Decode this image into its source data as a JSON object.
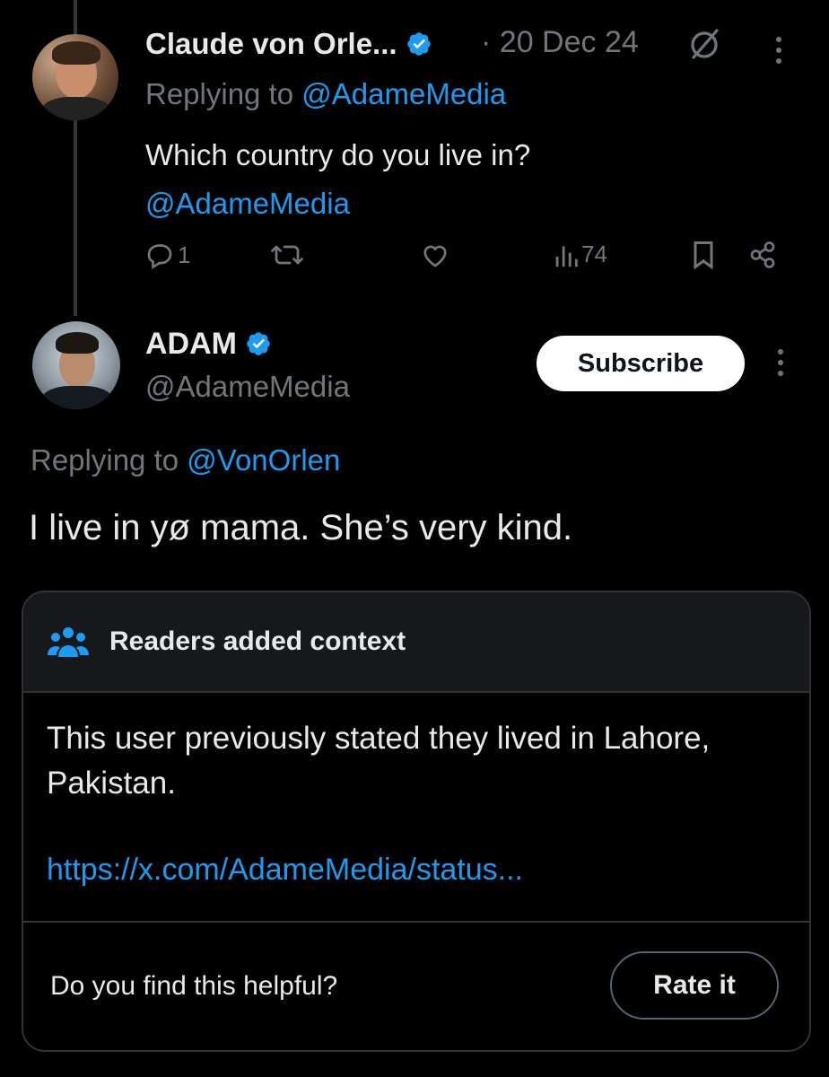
{
  "tweet1": {
    "display_name": "Claude von Orle...",
    "verified_icon": "verified-badge-icon",
    "separator": "·",
    "date": "20 Dec 24",
    "replying_prefix": "Replying to ",
    "replying_handle": "@AdameMedia",
    "text_line1": "Which country do you live in?",
    "text_line2": "@AdameMedia",
    "actions": {
      "reply_count": "1",
      "views_count": "74"
    }
  },
  "tweet2": {
    "display_name": "ADAM",
    "handle": "@AdameMedia",
    "subscribe_label": "Subscribe",
    "replying_prefix": "Replying to ",
    "replying_handle": "@VonOrlen",
    "text": "I live in yø mama. She’s very kind."
  },
  "community_note": {
    "title": "Readers added context",
    "text": "This user previously stated they lived in Lahore, Pakistan.",
    "link": "https://x.com/AdameMedia/status...",
    "question": "Do you find this helpful?",
    "rate_label": "Rate it"
  },
  "colors": {
    "background": "#000000",
    "text": "#e7e9ea",
    "muted": "#71767b",
    "accent": "#1d9bf0",
    "border": "#2f3336"
  }
}
